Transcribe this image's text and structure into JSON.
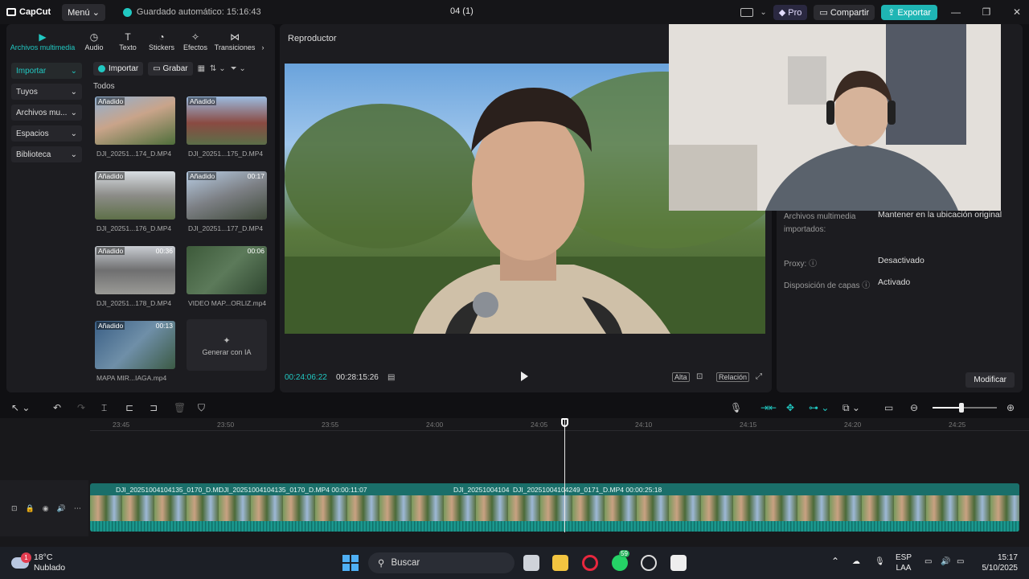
{
  "titlebar": {
    "app_name": "CapCut",
    "menu_label": "Menú",
    "autosave": "Guardado automático: 15:16:43",
    "project_title": "04 (1)",
    "pro_label": "Pro",
    "share_label": "Compartir",
    "export_label": "Exportar"
  },
  "tool_tabs": [
    "Archivos multimedia",
    "Audio",
    "Texto",
    "Stickers",
    "Efectos",
    "Transiciones"
  ],
  "side_nav": [
    "Importar",
    "Tuyos",
    "Archivos mu...",
    "Espacios",
    "Biblioteca"
  ],
  "media": {
    "import_label": "Importar",
    "record_label": "Grabar",
    "all_label": "Todos",
    "added_tag": "Añadido",
    "generate_ai": "Generar con IA",
    "items": [
      {
        "name": "DJI_20251...174_D.MP4",
        "duration": "",
        "added": true
      },
      {
        "name": "DJI_20251...175_D.MP4",
        "duration": "",
        "added": true
      },
      {
        "name": "DJI_20251...176_D.MP4",
        "duration": "",
        "added": true
      },
      {
        "name": "DJI_20251...177_D.MP4",
        "duration": "00:17",
        "added": true
      },
      {
        "name": "DJI_20251...178_D.MP4",
        "duration": "00:36",
        "added": true
      },
      {
        "name": "VIDEO MAP...ORLIZ.mp4",
        "duration": "00:06",
        "added": false
      },
      {
        "name": "MAPA MIR...IAGA.mp4",
        "duration": "00:13",
        "added": true
      }
    ]
  },
  "player": {
    "title": "Reproductor",
    "current_time": "00:24:06:22",
    "total_time": "00:28:15:26",
    "quality_label": "Alta",
    "ratio_label": "Relación"
  },
  "details": {
    "rows": [
      {
        "label": "Archivos multimedia importados:",
        "value": "Mantener en la ubicación original"
      },
      {
        "label": "Proxy:",
        "value": "Desactivado"
      },
      {
        "label": "Disposición de capas",
        "value": "Activado"
      }
    ],
    "modify_label": "Modificar"
  },
  "timeline": {
    "ticks": [
      "23:45",
      "23:50",
      "23:55",
      "24:00",
      "24:05",
      "24:10",
      "24:15",
      "24:20",
      "24:25"
    ],
    "clips": [
      {
        "label": "DJI_20251004104135_0170_D.MI"
      },
      {
        "label": "DJI_20251004104135_0170_D.MP4   00:00:11:07"
      },
      {
        "label": "DJI_20251004104"
      },
      {
        "label": "DJI_20251004104249_0171_D.MP4   00:00:25:18"
      }
    ],
    "zoom_level": 0.45
  },
  "taskbar": {
    "temperature": "18°C",
    "weather": "Nublado",
    "weather_badge": "1",
    "search_placeholder": "Buscar",
    "whatsapp_badge": "59",
    "language": "ESP",
    "keyboard": "LAA",
    "time": "15:17",
    "date": "5/10/2025"
  },
  "colors": {
    "accent": "#21c8c2",
    "panel": "#1c1c20",
    "background": "#101013"
  }
}
